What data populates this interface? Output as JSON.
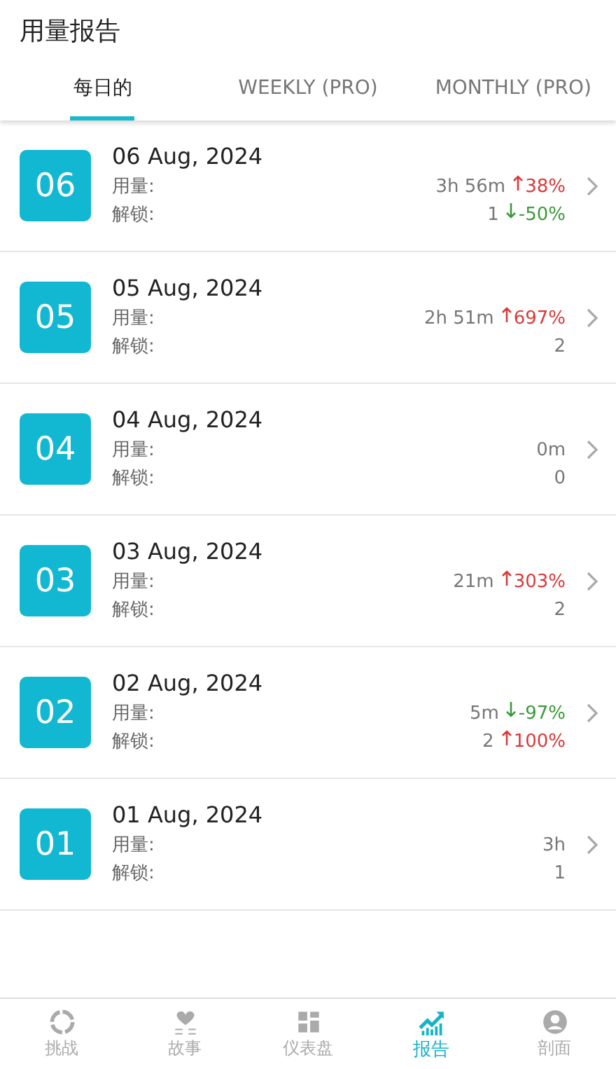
{
  "header": {
    "title": "用量报告"
  },
  "tabs": [
    {
      "label": "每日的",
      "selected": true
    },
    {
      "label": "WEEKLY (PRO)",
      "selected": false
    },
    {
      "label": "MONTHLY (PRO)",
      "selected": false
    }
  ],
  "days": [
    {
      "badge": "06",
      "date": "06 Aug, 2024",
      "usage_label": "用量:",
      "usage": "3h 56m",
      "usage_change": {
        "kind": "up",
        "text": "38%"
      },
      "unlock_label": "解锁:",
      "unlocks": "1",
      "unlock_change": {
        "kind": "down",
        "text": "-50%"
      }
    },
    {
      "badge": "05",
      "date": "05 Aug, 2024",
      "usage_label": "用量:",
      "usage": "2h 51m",
      "usage_change": {
        "kind": "up",
        "text": "697%"
      },
      "unlock_label": "解锁:",
      "unlocks": "2"
    },
    {
      "badge": "04",
      "date": "04 Aug, 2024",
      "usage_label": "用量:",
      "usage": "0m",
      "unlock_label": "解锁:",
      "unlocks": "0"
    },
    {
      "badge": "03",
      "date": "03 Aug, 2024",
      "usage_label": "用量:",
      "usage": "21m",
      "usage_change": {
        "kind": "up",
        "text": "303%"
      },
      "unlock_label": "解锁:",
      "unlocks": "2"
    },
    {
      "badge": "02",
      "date": "02 Aug, 2024",
      "usage_label": "用量:",
      "usage": "5m",
      "usage_change": {
        "kind": "down",
        "text": "-97%"
      },
      "unlock_label": "解锁:",
      "unlocks": "2",
      "unlock_change": {
        "kind": "up",
        "text": "100%"
      }
    },
    {
      "badge": "01",
      "date": "01 Aug, 2024",
      "usage_label": "用量:",
      "usage": "3h",
      "unlock_label": "解锁:",
      "unlocks": "1"
    }
  ],
  "nav": [
    {
      "kind": "challenge",
      "label": "挑战",
      "selected": false
    },
    {
      "kind": "story",
      "label": "故事",
      "selected": false
    },
    {
      "kind": "dashboard",
      "label": "仪表盘",
      "selected": false
    },
    {
      "kind": "report",
      "label": "报告",
      "selected": true
    },
    {
      "kind": "profile",
      "label": "剖面",
      "selected": false
    }
  ]
}
